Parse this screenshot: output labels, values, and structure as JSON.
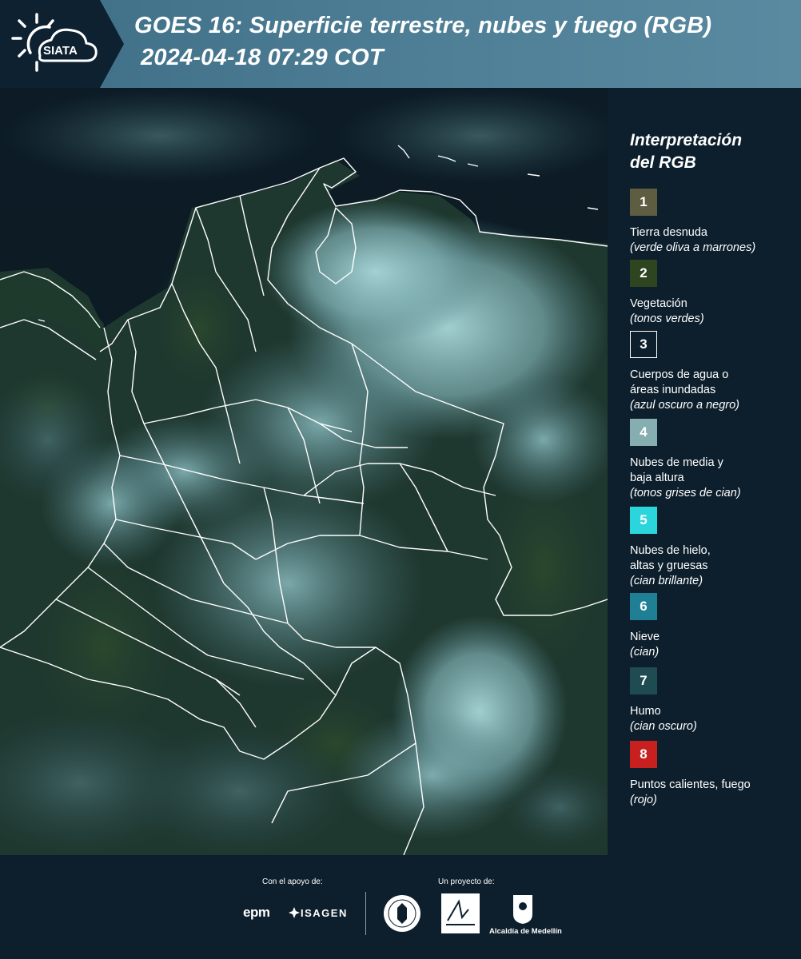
{
  "header": {
    "logo_text": "SIATA",
    "title_line1": "GOES 16: Superficie terrestre, nubes y fuego (RGB)",
    "title_line2": "2024-04-18 07:29 COT"
  },
  "legend": {
    "title_line1": "Interpretación",
    "title_line2": "del RGB",
    "items": [
      {
        "number": "1",
        "color": "#5e5d42",
        "label": "Tierra desnuda",
        "sub": "(verde oliva a marrones)"
      },
      {
        "number": "2",
        "color": "#2e4520",
        "label": "Vegetación",
        "sub": "(tonos verdes)"
      },
      {
        "number": "3",
        "color": "#0d1f2c",
        "label_lines": [
          "Cuerpos de agua o",
          "áreas inundadas"
        ],
        "sub": "(azul oscuro a negro)"
      },
      {
        "number": "4",
        "color": "#86aeb0",
        "label_lines": [
          "Nubes de media y",
          "baja altura"
        ],
        "sub": "(tonos grises de cian)"
      },
      {
        "number": "5",
        "color": "#2ad6dc",
        "label_lines": [
          "Nubes de hielo,",
          "altas y gruesas"
        ],
        "sub": "(cian brillante)"
      },
      {
        "number": "6",
        "color": "#1f7f95",
        "label": "Nieve",
        "sub": "(cian)"
      },
      {
        "number": "7",
        "color": "#1e4c52",
        "label": "Humo",
        "sub": "(cian oscuro)"
      },
      {
        "number": "8",
        "color": "#c81f1f",
        "label": "Puntos calientes, fuego",
        "sub": "(rojo)"
      }
    ]
  },
  "footer": {
    "support_caption": "Con el apoyo de:",
    "project_caption": "Un proyecto de:",
    "sponsor_1": "epm",
    "sponsor_2": "ISAGEN",
    "partner_3": "Alcaldía de Medellín"
  },
  "map": {
    "satellite": "GOES 16",
    "product": "RGB",
    "colors": {
      "ocean": "#0a1822",
      "land": "#1f3a2d",
      "cloud_low": "#6f9ea5",
      "cloud_bright": "#9fd2d4",
      "borders": "#ffffff"
    }
  }
}
